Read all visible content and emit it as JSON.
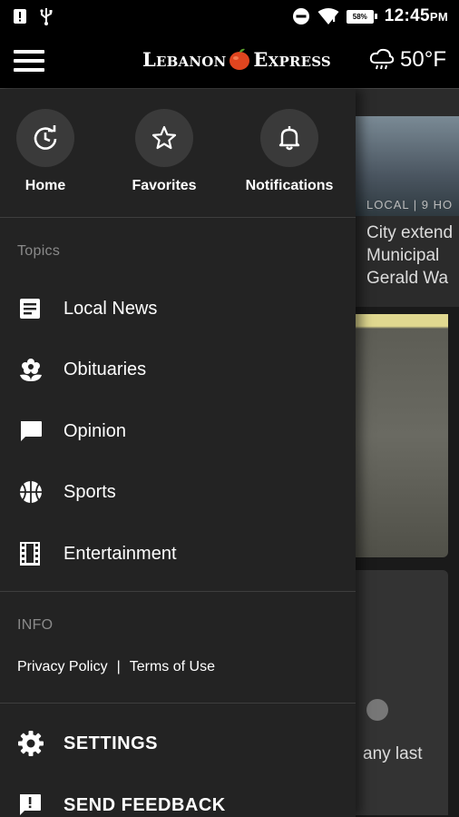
{
  "status_bar": {
    "battery": "58%",
    "time": "12:45",
    "ampm": "PM"
  },
  "app_bar": {
    "logo_left": "Lebanon",
    "logo_right": "Express",
    "weather": "50°F"
  },
  "quick_actions": [
    {
      "label": "Home",
      "icon": "home-refresh-icon"
    },
    {
      "label": "Favorites",
      "icon": "star-icon"
    },
    {
      "label": "Notifications",
      "icon": "bell-icon"
    }
  ],
  "topics": {
    "heading": "Topics",
    "items": [
      {
        "label": "Local News",
        "icon": "article-icon"
      },
      {
        "label": "Obituaries",
        "icon": "flower-icon"
      },
      {
        "label": "Opinion",
        "icon": "chat-bubble-icon"
      },
      {
        "label": "Sports",
        "icon": "basketball-icon"
      },
      {
        "label": "Entertainment",
        "icon": "film-icon"
      }
    ]
  },
  "info": {
    "heading": "INFO",
    "privacy": "Privacy Policy",
    "separator": "|",
    "terms": "Terms of Use"
  },
  "footer": {
    "settings": "SETTINGS",
    "feedback": "SEND FEEDBACK"
  },
  "background": {
    "tag": "LOCAL | 9 HO",
    "headline_1": "City extend",
    "headline_2": "Municipal",
    "headline_3": "Gerald Wa",
    "card_text": "any last"
  },
  "colors": {
    "drawer_bg": "#232323",
    "app_bar_bg": "#000000",
    "logo_apple": "#e0451f"
  }
}
